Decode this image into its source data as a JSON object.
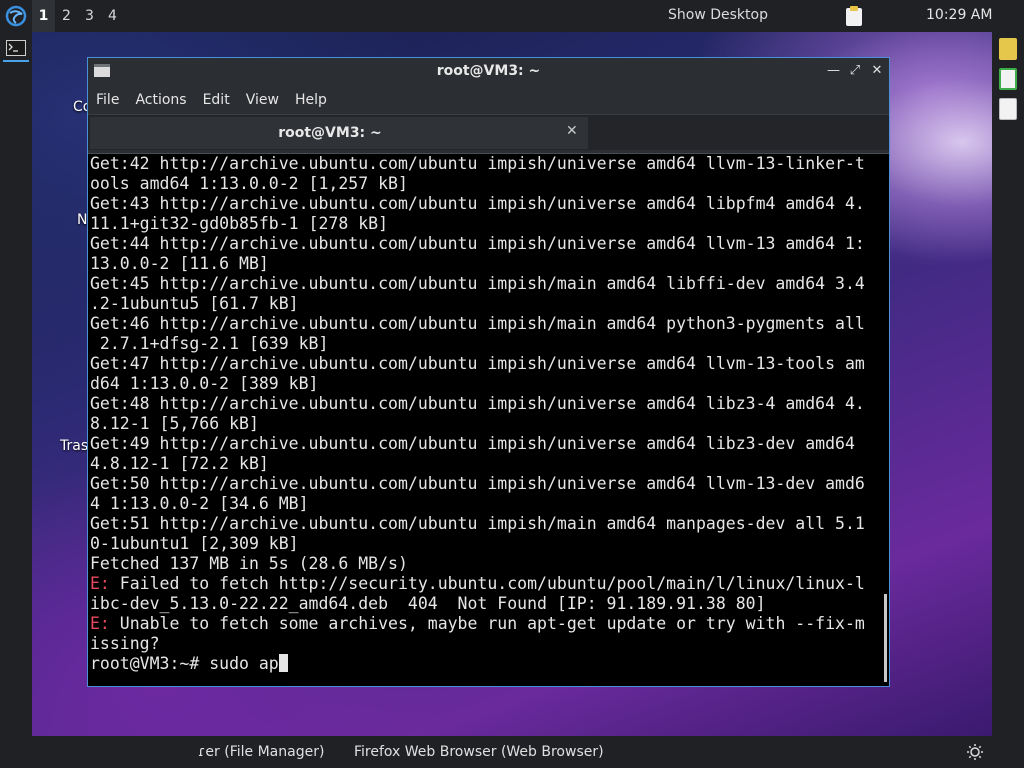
{
  "top_panel": {
    "workspaces": [
      "1",
      "2",
      "3",
      "4"
    ],
    "active_workspace": "1",
    "show_desktop": "Show Desktop",
    "clock": "10:29 AM"
  },
  "desktop": {
    "labels": [
      "Co",
      "N",
      "Tras"
    ]
  },
  "window": {
    "title": "root@VM3: ~",
    "menu": [
      "File",
      "Actions",
      "Edit",
      "View",
      "Help"
    ],
    "tab_title": "root@VM3: ~"
  },
  "terminal": {
    "lines": [
      {
        "text": "Get:42 http://archive.ubuntu.com/ubuntu impish/universe amd64 llvm-13-linker-t"
      },
      {
        "text": "ools amd64 1:13.0.0-2 [1,257 kB]"
      },
      {
        "text": "Get:43 http://archive.ubuntu.com/ubuntu impish/universe amd64 libpfm4 amd64 4."
      },
      {
        "text": "11.1+git32-gd0b85fb-1 [278 kB]"
      },
      {
        "text": "Get:44 http://archive.ubuntu.com/ubuntu impish/universe amd64 llvm-13 amd64 1:"
      },
      {
        "text": "13.0.0-2 [11.6 MB]"
      },
      {
        "text": "Get:45 http://archive.ubuntu.com/ubuntu impish/main amd64 libffi-dev amd64 3.4"
      },
      {
        "text": ".2-1ubuntu5 [61.7 kB]"
      },
      {
        "text": "Get:46 http://archive.ubuntu.com/ubuntu impish/main amd64 python3-pygments all"
      },
      {
        "text": " 2.7.1+dfsg-2.1 [639 kB]"
      },
      {
        "text": "Get:47 http://archive.ubuntu.com/ubuntu impish/universe amd64 llvm-13-tools am"
      },
      {
        "text": "d64 1:13.0.0-2 [389 kB]"
      },
      {
        "text": "Get:48 http://archive.ubuntu.com/ubuntu impish/universe amd64 libz3-4 amd64 4."
      },
      {
        "text": "8.12-1 [5,766 kB]"
      },
      {
        "text": "Get:49 http://archive.ubuntu.com/ubuntu impish/universe amd64 libz3-dev amd64"
      },
      {
        "text": "4.8.12-1 [72.2 kB]"
      },
      {
        "text": "Get:50 http://archive.ubuntu.com/ubuntu impish/universe amd64 llvm-13-dev amd6"
      },
      {
        "text": "4 1:13.0.0-2 [34.6 MB]"
      },
      {
        "text": "Get:51 http://archive.ubuntu.com/ubuntu impish/main amd64 manpages-dev all 5.1"
      },
      {
        "text": "0-1ubuntu1 [2,309 kB]"
      },
      {
        "text": "Fetched 137 MB in 5s (28.6 MB/s)"
      },
      {
        "prefix": "E:",
        "text": " Failed to fetch http://security.ubuntu.com/ubuntu/pool/main/l/linux/linux-l"
      },
      {
        "text": "ibc-dev_5.13.0-22.22_amd64.deb  404  Not Found [IP: 91.189.91.38 80]"
      },
      {
        "prefix": "E:",
        "text": " Unable to fetch some archives, maybe run apt-get update or try with --fix-m"
      },
      {
        "text": "issing?"
      }
    ],
    "prompt": "root@VM3:~# sudo ap"
  },
  "taskbar": {
    "items": [
      "ɾer (File Manager)",
      "Firefox Web Browser (Web Browser)"
    ]
  }
}
